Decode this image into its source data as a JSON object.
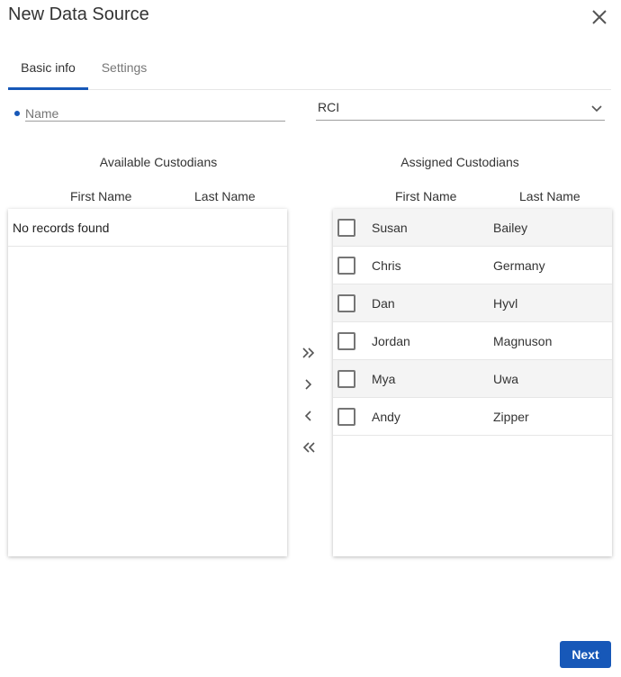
{
  "dialog": {
    "title": "New Data Source"
  },
  "tabs": [
    {
      "label": "Basic info",
      "active": true
    },
    {
      "label": "Settings",
      "active": false
    }
  ],
  "form": {
    "name_placeholder": "Name",
    "name_value": "",
    "source_selected": "RCI"
  },
  "available": {
    "title": "Available Custodians",
    "columns": [
      "First Name",
      "Last Name"
    ],
    "empty_text": "No records found"
  },
  "assigned": {
    "title": "Assigned Custodians",
    "columns": [
      "First Name",
      "Last Name"
    ],
    "rows": [
      {
        "first": "Susan",
        "last": "Bailey"
      },
      {
        "first": "Chris",
        "last": "Germany"
      },
      {
        "first": "Dan",
        "last": "Hyvl"
      },
      {
        "first": "Jordan",
        "last": "Magnuson"
      },
      {
        "first": "Mya",
        "last": "Uwa"
      },
      {
        "first": "Andy",
        "last": "Zipper"
      }
    ]
  },
  "transfer_icons": [
    "double-chevron-right-icon",
    "chevron-right-icon",
    "chevron-left-icon",
    "double-chevron-left-icon"
  ],
  "footer": {
    "next_label": "Next"
  },
  "colors": {
    "accent": "#1758b8",
    "row_alt": "#f4f4f4"
  }
}
